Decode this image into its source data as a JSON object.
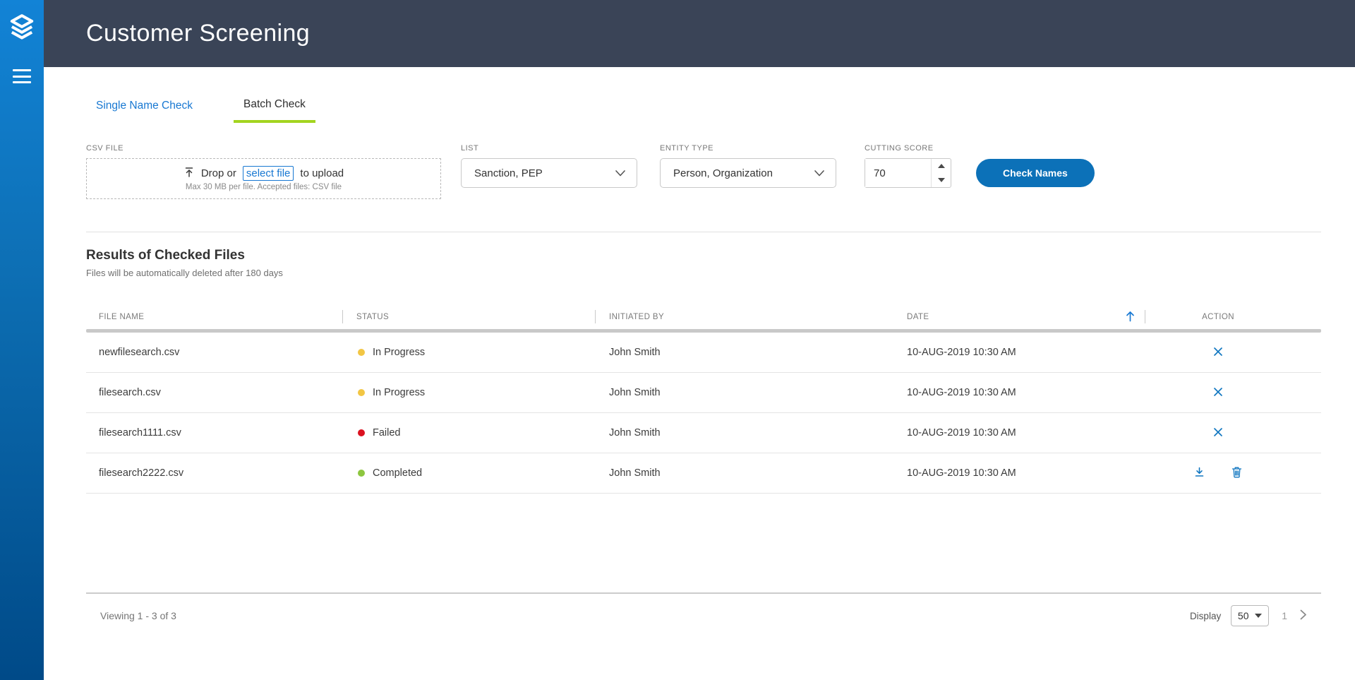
{
  "app": {
    "title": "Customer Screening"
  },
  "tabs": {
    "single": "Single Name Check",
    "batch": "Batch Check"
  },
  "form": {
    "csv_file": {
      "label": "CSV FILE",
      "drop_prefix": "Drop or",
      "select_link": "select file",
      "drop_suffix": "to upload",
      "hint": "Max 30 MB per file. Accepted files: CSV file"
    },
    "list": {
      "label": "LIST",
      "value": "Sanction, PEP"
    },
    "entity_type": {
      "label": "ENTITY TYPE",
      "value": "Person, Organization"
    },
    "cutting_score": {
      "label": "CUTTING SCORE",
      "value": "70"
    },
    "check_button": "Check Names"
  },
  "results": {
    "title": "Results of Checked Files",
    "subtitle": "Files will be automatically deleted after 180 days",
    "columns": {
      "file_name": "FILE NAME",
      "status": "STATUS",
      "initiated_by": "INITIATED BY",
      "date": "DATE",
      "action": "ACTION"
    },
    "rows": [
      {
        "file_name": "newfilesearch.csv",
        "status": "In Progress",
        "status_color": "#f2c644",
        "initiated_by": "John Smith",
        "date": "10-AUG-2019 10:30 AM"
      },
      {
        "file_name": "filesearch.csv",
        "status": "In Progress",
        "status_color": "#f2c644",
        "initiated_by": "John Smith",
        "date": "10-AUG-2019 10:30 AM"
      },
      {
        "file_name": "filesearch1111.csv",
        "status": "Failed",
        "status_color": "#db1220",
        "initiated_by": "John Smith",
        "date": "10-AUG-2019 10:30 AM"
      },
      {
        "file_name": "filesearch2222.csv",
        "status": "Completed",
        "status_color": "#8dc63f",
        "initiated_by": "John Smith",
        "date": "10-AUG-2019 10:30 AM"
      }
    ]
  },
  "pagination": {
    "viewing": "Viewing 1 - 3 of 3",
    "display_label": "Display",
    "display_value": "50",
    "page": "1"
  },
  "icons": {
    "menu": "☰",
    "upload": "⤒",
    "chevron_down": "⌄",
    "spinner_up": "▲",
    "spinner_down": "▼",
    "sort_ascending": "↑",
    "cancel": "✕",
    "download": "⤓",
    "trash": "🗑",
    "caret_down": "▾",
    "chevron_right": "›"
  },
  "colors": {
    "header_bg": "#3a4457",
    "sidebar_top": "#1283d6",
    "sidebar_bottom": "#004a88",
    "link_blue": "#1878d2",
    "button_blue": "#0c71b8",
    "action_icon_blue": "#1076c0",
    "tab_underline_green": "#a3d41f",
    "status_in_progress": "#f2c644",
    "status_failed": "#db1220",
    "status_completed": "#8dc63f"
  }
}
